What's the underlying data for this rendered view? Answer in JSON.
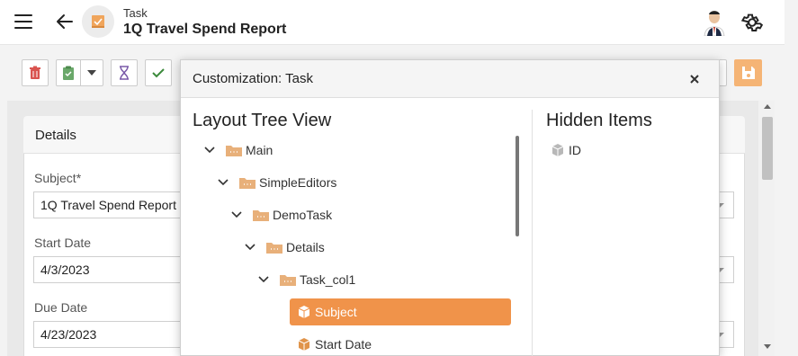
{
  "header": {
    "caption": "Task",
    "title": "1Q Travel Spend Report"
  },
  "icons": {
    "menu": "hamburger-icon",
    "back": "back-arrow-icon",
    "app": "task-icon",
    "avatar": "user-avatar",
    "settings": "gear-icon"
  },
  "toolbar": {
    "delete": "trash-icon",
    "paste": "clipboard-icon",
    "paste_dropdown": "chevron-down-icon",
    "filter": "hourglass-icon",
    "validate": "check-icon",
    "save": "floppy-disk-icon"
  },
  "details": {
    "title": "Details",
    "fields": [
      {
        "label": "Subject*",
        "value": "1Q Travel Spend Report"
      },
      {
        "label": "Start Date",
        "value": "4/3/2023"
      },
      {
        "label": "Due Date",
        "value": "4/23/2023"
      }
    ]
  },
  "dialog": {
    "title": "Customization: Task",
    "layout_tree_title": "Layout Tree View",
    "hidden_items_title": "Hidden Items",
    "tree": [
      {
        "label": "Main"
      },
      {
        "label": "SimpleEditors"
      },
      {
        "label": "DemoTask"
      },
      {
        "label": "Details"
      },
      {
        "label": "Task_col1"
      },
      {
        "label": "Subject"
      },
      {
        "label": "Start Date"
      }
    ],
    "hidden_items": [
      {
        "label": "ID"
      }
    ]
  },
  "colors": {
    "accent": "#f0934a",
    "save_button": "#f5b475",
    "folder": "#e8b07a"
  }
}
